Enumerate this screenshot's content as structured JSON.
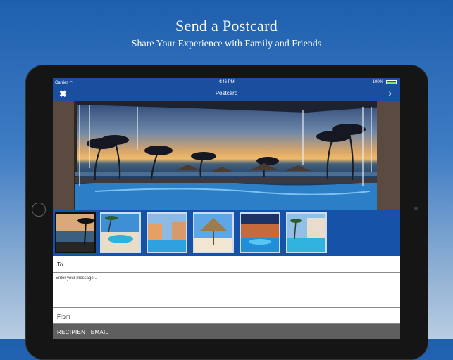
{
  "headline": {
    "title": "Send a Postcard",
    "subtitle": "Share Your Experience with Family and Friends"
  },
  "statusbar": {
    "carrier": "Carrier",
    "time": "4:46 PM",
    "battery": "100%"
  },
  "navbar": {
    "title": "Postcard",
    "close_icon": "close-x-icon",
    "next_icon": "chevron-right-icon"
  },
  "thumbnails": [
    {
      "name": "beach-sunset-photo",
      "selected": true
    },
    {
      "name": "pool-loungers-photo",
      "selected": false
    },
    {
      "name": "resort-pool-buildings-photo",
      "selected": false
    },
    {
      "name": "thatched-hut-beach-photo",
      "selected": false
    },
    {
      "name": "night-pool-photo",
      "selected": false
    },
    {
      "name": "pool-courtyard-photo",
      "selected": false
    }
  ],
  "form": {
    "to_label": "To",
    "message_placeholder": "Enter your message...",
    "from_label": "From",
    "recipient_email_header": "RECIPIENT EMAIL"
  },
  "colors": {
    "navbar": "#1a4fa0",
    "thumbstrip": "#1652a8",
    "section_header": "#5f5f5f"
  }
}
